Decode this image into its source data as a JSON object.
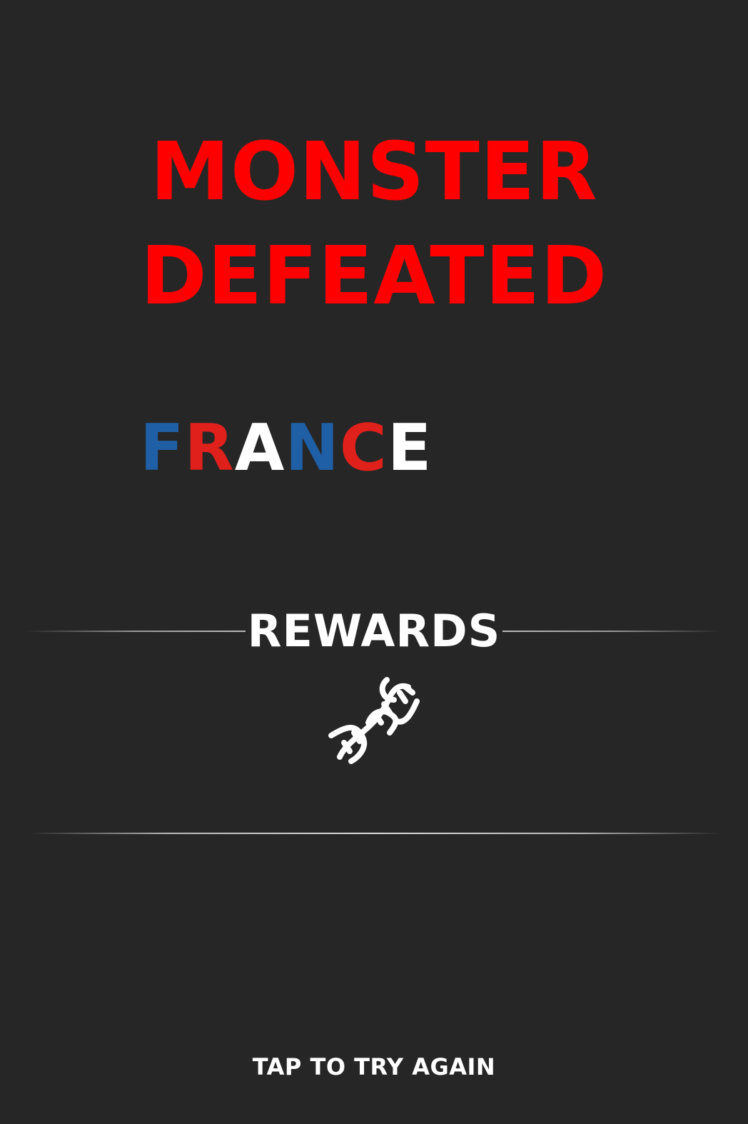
{
  "title": {
    "line1": "MONSTER",
    "line2": "DEFEATED",
    "color": "#ff0000"
  },
  "country": {
    "name": "FRANCE",
    "letters": [
      {
        "char": "F",
        "color": "#1f5fa6"
      },
      {
        "char": "R",
        "color": "#e0201b"
      },
      {
        "char": "A",
        "color": "#ffffff"
      },
      {
        "char": "N",
        "color": "#1f5fa6"
      },
      {
        "char": "C",
        "color": "#e0201b"
      },
      {
        "char": "E",
        "color": "#ffffff"
      }
    ]
  },
  "rewards": {
    "label": "REWARDS",
    "icon": "dna-icon"
  },
  "footer": {
    "tap_label": "TAP TO TRY AGAIN"
  },
  "colors": {
    "background": "#262626",
    "text": "#ffffff"
  }
}
